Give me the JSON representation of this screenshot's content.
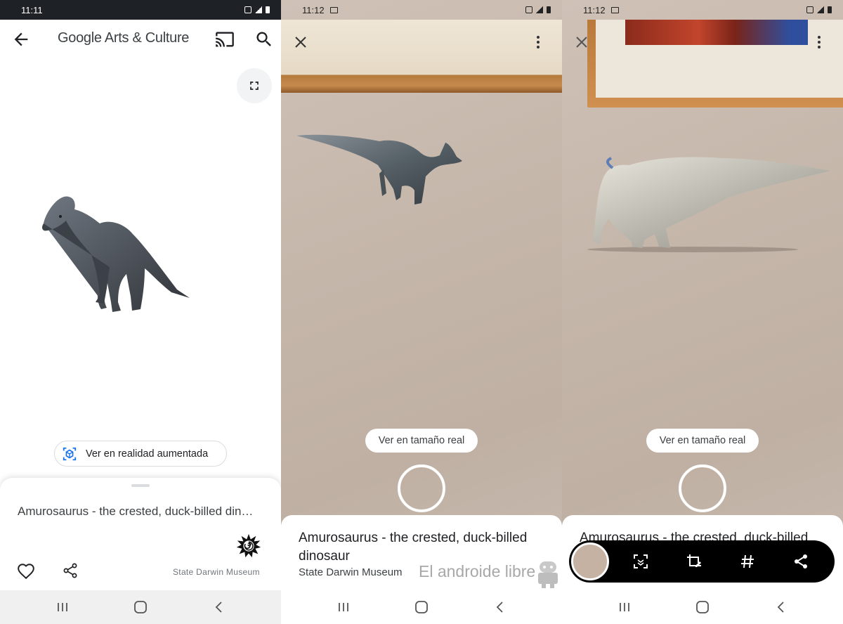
{
  "screen1": {
    "status_time": "11:11",
    "app_title": "Google Arts & Culture",
    "ar_button_label": "Ver en realidad aumentada",
    "asset_title": "Amurosaurus - the crested, duck-billed din…",
    "museum": "State Darwin Museum",
    "icons": [
      "back-arrow-icon",
      "cast-icon",
      "search-icon",
      "fullscreen-icon",
      "ar-view-icon",
      "heart-icon",
      "share-icon",
      "museum-logo-icon"
    ]
  },
  "screen2": {
    "status_time": "11:12",
    "real_size_pill": "Ver en tamaño real",
    "card_title": "Amurosaurus - the crested, duck-billed dinosaur",
    "card_museum": "State Darwin Museum",
    "watermark": "El androide libre",
    "icons": [
      "close-icon",
      "more-vert-icon",
      "shutter-button"
    ]
  },
  "screen3": {
    "status_time": "11:12",
    "real_size_pill": "Ver en tamaño real",
    "card_title": "Amurosaurus - the crested, duck-billed dinosaur",
    "icons": [
      "close-icon",
      "more-vert-icon",
      "scan-icon",
      "crop-edit-icon",
      "hashtag-icon",
      "share-icon"
    ]
  },
  "colors": {
    "status_dark": "#1e2226",
    "wall": "#c5b6aa",
    "frame_wood": "#c68a4c",
    "share_bar": "#000000"
  }
}
